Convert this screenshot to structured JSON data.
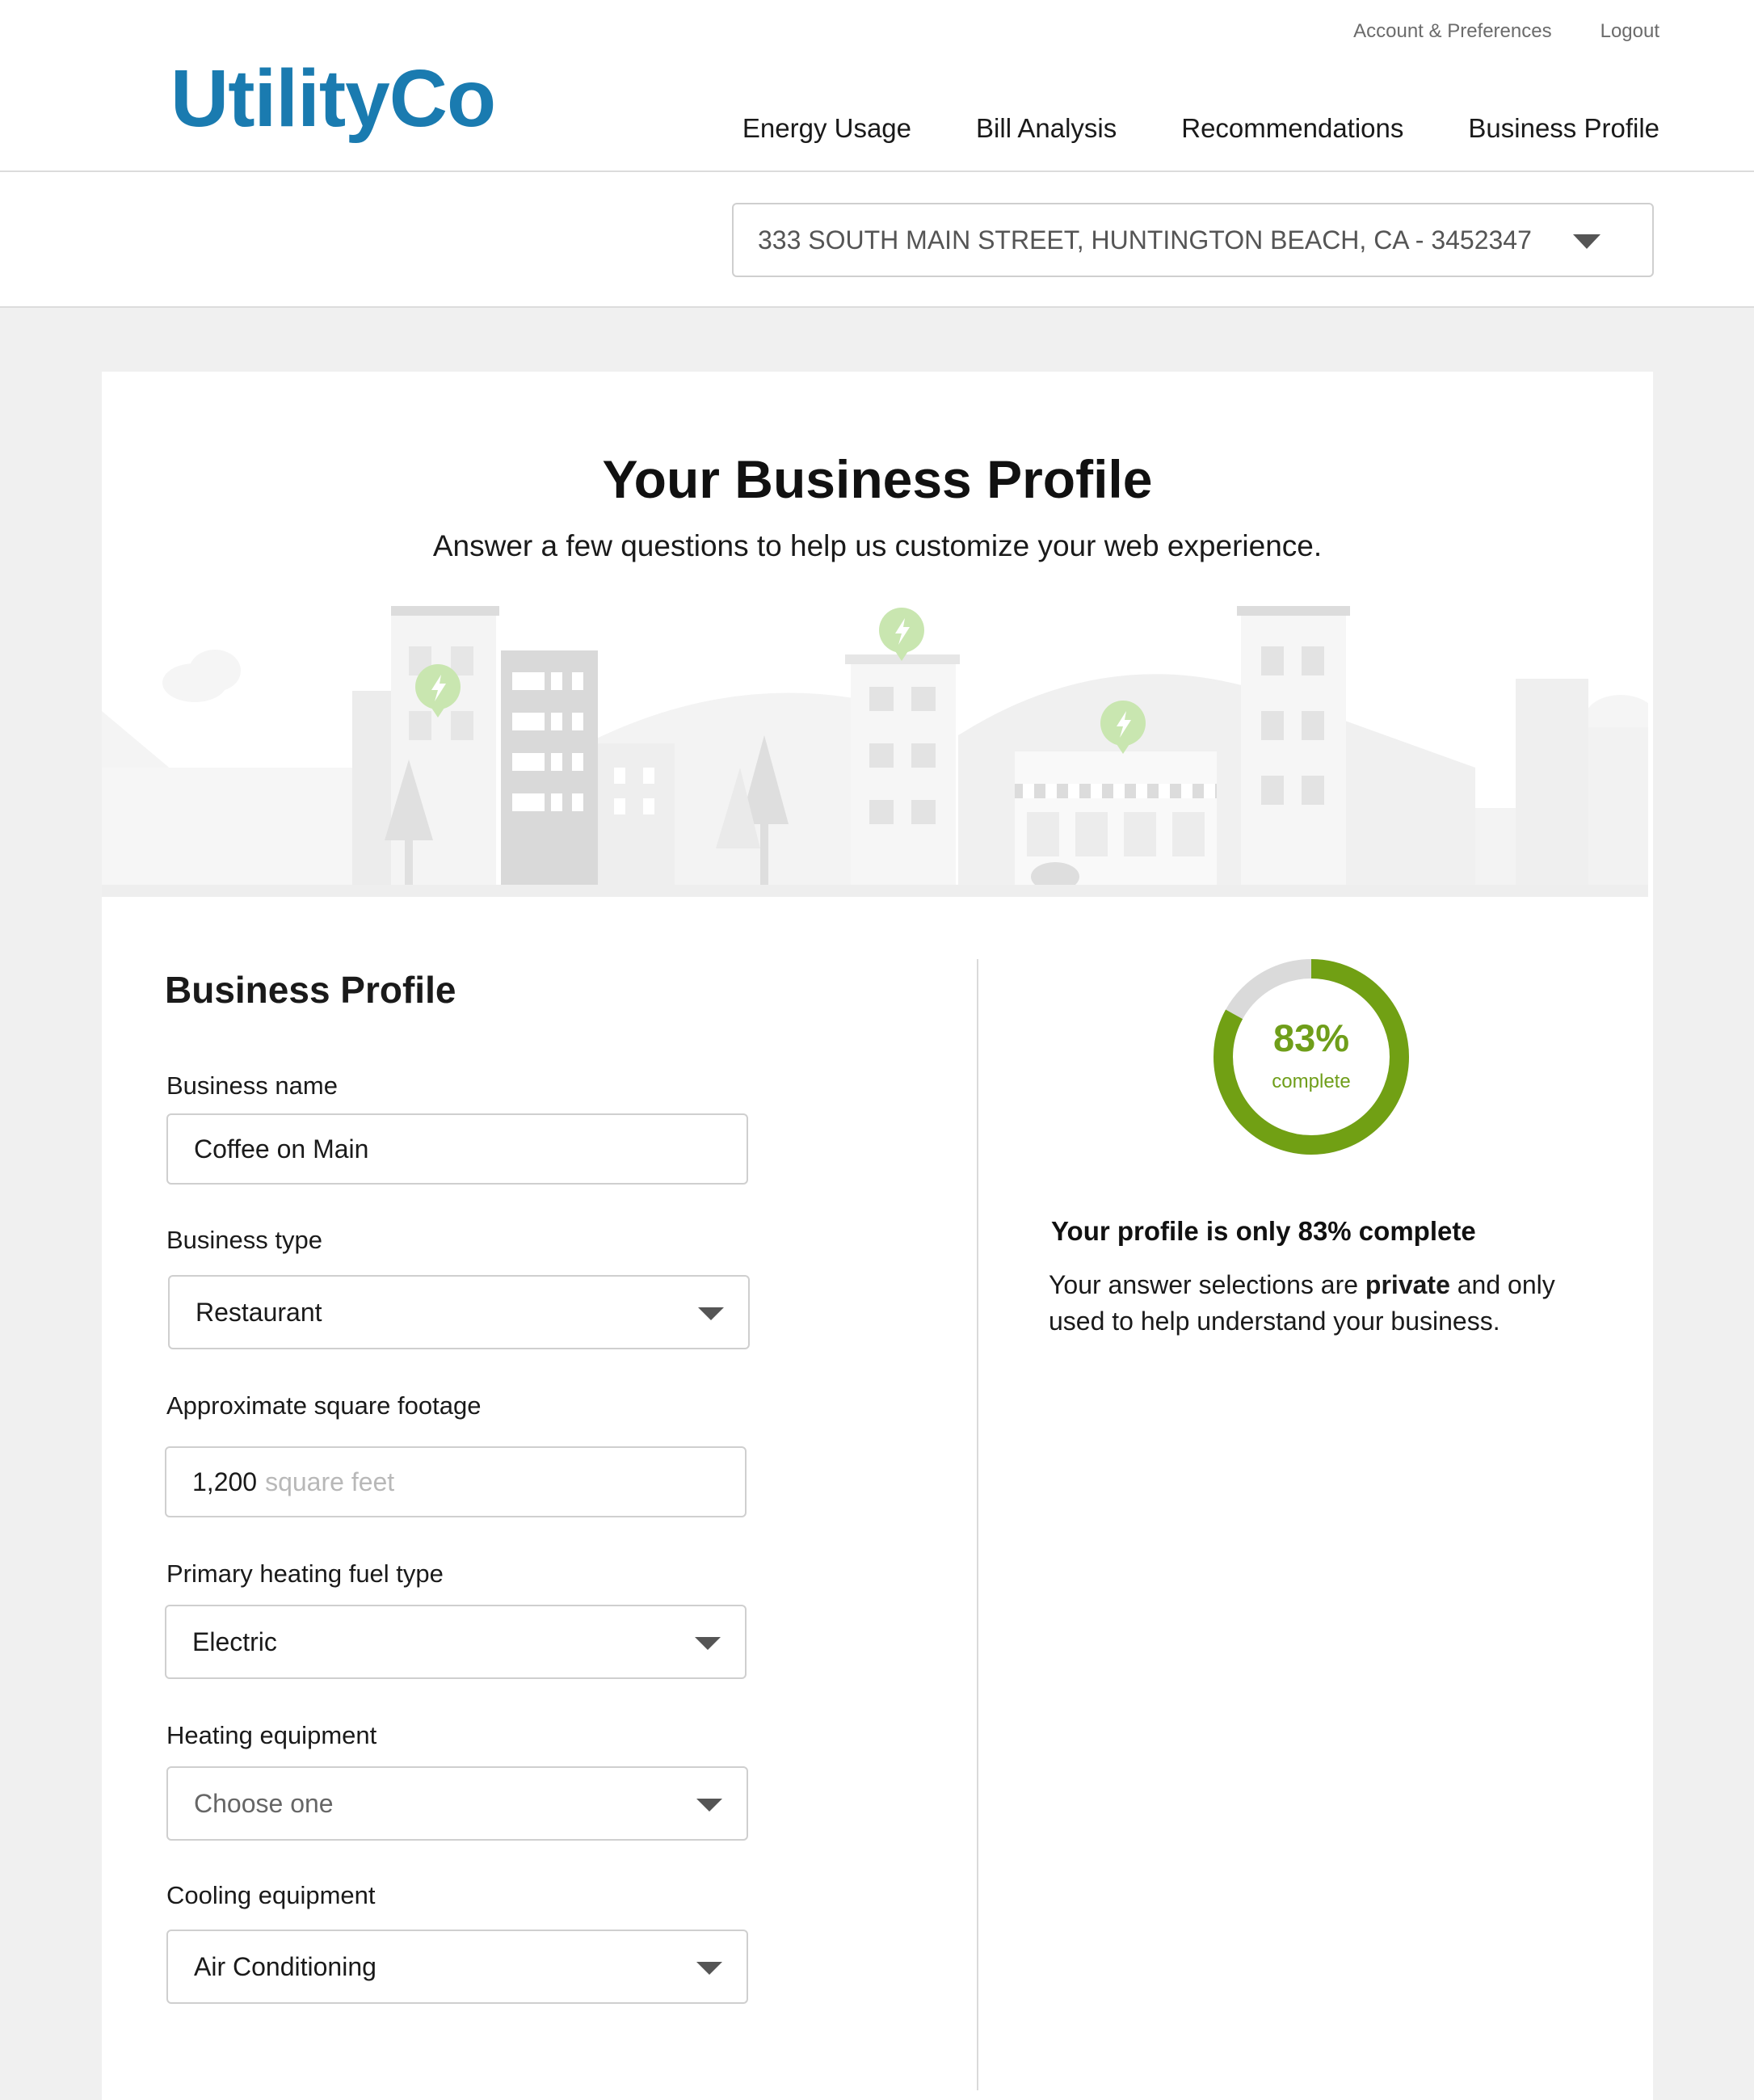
{
  "header": {
    "logo": "UtilityCo",
    "account_link": "Account & Preferences",
    "logout_link": "Logout",
    "nav": [
      "Energy Usage",
      "Bill Analysis",
      "Recommendations",
      "Business Profile"
    ],
    "brand_color": "#1a7bb0"
  },
  "address": {
    "selected": "333 SOUTH MAIN STREET, HUNTINGTON BEACH, CA - 3452347"
  },
  "hero": {
    "title": "Your Business Profile",
    "subtitle": "Answer a few questions to help us customize your web experience."
  },
  "form": {
    "title": "Business Profile",
    "business_name": {
      "label": "Business name",
      "value": "Coffee on Main"
    },
    "business_type": {
      "label": "Business type",
      "value": "Restaurant"
    },
    "square_footage": {
      "label": "Approximate square footage",
      "value": "1,200",
      "unit": "square feet"
    },
    "heating_fuel": {
      "label": "Primary heating fuel type",
      "value": "Electric"
    },
    "heating_equipment": {
      "label": "Heating equipment",
      "value": "Choose one"
    },
    "cooling_equipment": {
      "label": "Cooling equipment",
      "value": "Air Conditioning"
    }
  },
  "progress": {
    "percent_label": "83%",
    "complete_label": "complete",
    "fraction": 0.83,
    "accent_color": "#71a014",
    "message": "Your profile is only 83% complete",
    "note_before": "Your answer selections are ",
    "note_bold": "private",
    "note_after": " and only used to help understand your business."
  }
}
